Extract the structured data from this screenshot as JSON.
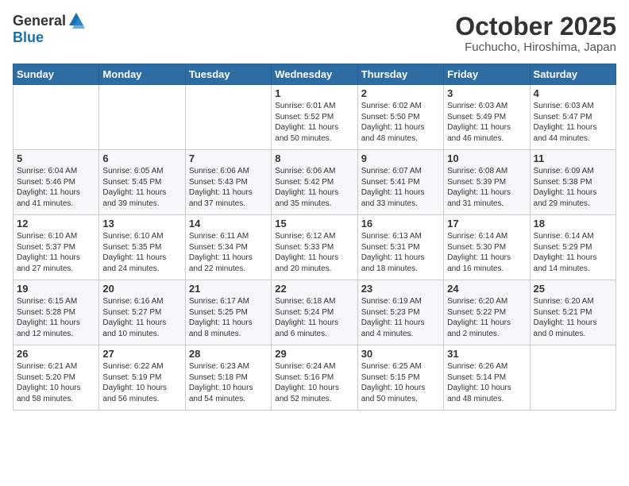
{
  "header": {
    "logo_general": "General",
    "logo_blue": "Blue",
    "month_title": "October 2025",
    "location": "Fuchucho, Hiroshima, Japan"
  },
  "days_of_week": [
    "Sunday",
    "Monday",
    "Tuesday",
    "Wednesday",
    "Thursday",
    "Friday",
    "Saturday"
  ],
  "weeks": [
    [
      {
        "day": "",
        "info": ""
      },
      {
        "day": "",
        "info": ""
      },
      {
        "day": "",
        "info": ""
      },
      {
        "day": "1",
        "info": "Sunrise: 6:01 AM\nSunset: 5:52 PM\nDaylight: 11 hours\nand 50 minutes."
      },
      {
        "day": "2",
        "info": "Sunrise: 6:02 AM\nSunset: 5:50 PM\nDaylight: 11 hours\nand 48 minutes."
      },
      {
        "day": "3",
        "info": "Sunrise: 6:03 AM\nSunset: 5:49 PM\nDaylight: 11 hours\nand 46 minutes."
      },
      {
        "day": "4",
        "info": "Sunrise: 6:03 AM\nSunset: 5:47 PM\nDaylight: 11 hours\nand 44 minutes."
      }
    ],
    [
      {
        "day": "5",
        "info": "Sunrise: 6:04 AM\nSunset: 5:46 PM\nDaylight: 11 hours\nand 41 minutes."
      },
      {
        "day": "6",
        "info": "Sunrise: 6:05 AM\nSunset: 5:45 PM\nDaylight: 11 hours\nand 39 minutes."
      },
      {
        "day": "7",
        "info": "Sunrise: 6:06 AM\nSunset: 5:43 PM\nDaylight: 11 hours\nand 37 minutes."
      },
      {
        "day": "8",
        "info": "Sunrise: 6:06 AM\nSunset: 5:42 PM\nDaylight: 11 hours\nand 35 minutes."
      },
      {
        "day": "9",
        "info": "Sunrise: 6:07 AM\nSunset: 5:41 PM\nDaylight: 11 hours\nand 33 minutes."
      },
      {
        "day": "10",
        "info": "Sunrise: 6:08 AM\nSunset: 5:39 PM\nDaylight: 11 hours\nand 31 minutes."
      },
      {
        "day": "11",
        "info": "Sunrise: 6:09 AM\nSunset: 5:38 PM\nDaylight: 11 hours\nand 29 minutes."
      }
    ],
    [
      {
        "day": "12",
        "info": "Sunrise: 6:10 AM\nSunset: 5:37 PM\nDaylight: 11 hours\nand 27 minutes."
      },
      {
        "day": "13",
        "info": "Sunrise: 6:10 AM\nSunset: 5:35 PM\nDaylight: 11 hours\nand 24 minutes."
      },
      {
        "day": "14",
        "info": "Sunrise: 6:11 AM\nSunset: 5:34 PM\nDaylight: 11 hours\nand 22 minutes."
      },
      {
        "day": "15",
        "info": "Sunrise: 6:12 AM\nSunset: 5:33 PM\nDaylight: 11 hours\nand 20 minutes."
      },
      {
        "day": "16",
        "info": "Sunrise: 6:13 AM\nSunset: 5:31 PM\nDaylight: 11 hours\nand 18 minutes."
      },
      {
        "day": "17",
        "info": "Sunrise: 6:14 AM\nSunset: 5:30 PM\nDaylight: 11 hours\nand 16 minutes."
      },
      {
        "day": "18",
        "info": "Sunrise: 6:14 AM\nSunset: 5:29 PM\nDaylight: 11 hours\nand 14 minutes."
      }
    ],
    [
      {
        "day": "19",
        "info": "Sunrise: 6:15 AM\nSunset: 5:28 PM\nDaylight: 11 hours\nand 12 minutes."
      },
      {
        "day": "20",
        "info": "Sunrise: 6:16 AM\nSunset: 5:27 PM\nDaylight: 11 hours\nand 10 minutes."
      },
      {
        "day": "21",
        "info": "Sunrise: 6:17 AM\nSunset: 5:25 PM\nDaylight: 11 hours\nand 8 minutes."
      },
      {
        "day": "22",
        "info": "Sunrise: 6:18 AM\nSunset: 5:24 PM\nDaylight: 11 hours\nand 6 minutes."
      },
      {
        "day": "23",
        "info": "Sunrise: 6:19 AM\nSunset: 5:23 PM\nDaylight: 11 hours\nand 4 minutes."
      },
      {
        "day": "24",
        "info": "Sunrise: 6:20 AM\nSunset: 5:22 PM\nDaylight: 11 hours\nand 2 minutes."
      },
      {
        "day": "25",
        "info": "Sunrise: 6:20 AM\nSunset: 5:21 PM\nDaylight: 11 hours\nand 0 minutes."
      }
    ],
    [
      {
        "day": "26",
        "info": "Sunrise: 6:21 AM\nSunset: 5:20 PM\nDaylight: 10 hours\nand 58 minutes."
      },
      {
        "day": "27",
        "info": "Sunrise: 6:22 AM\nSunset: 5:19 PM\nDaylight: 10 hours\nand 56 minutes."
      },
      {
        "day": "28",
        "info": "Sunrise: 6:23 AM\nSunset: 5:18 PM\nDaylight: 10 hours\nand 54 minutes."
      },
      {
        "day": "29",
        "info": "Sunrise: 6:24 AM\nSunset: 5:16 PM\nDaylight: 10 hours\nand 52 minutes."
      },
      {
        "day": "30",
        "info": "Sunrise: 6:25 AM\nSunset: 5:15 PM\nDaylight: 10 hours\nand 50 minutes."
      },
      {
        "day": "31",
        "info": "Sunrise: 6:26 AM\nSunset: 5:14 PM\nDaylight: 10 hours\nand 48 minutes."
      },
      {
        "day": "",
        "info": ""
      }
    ]
  ]
}
